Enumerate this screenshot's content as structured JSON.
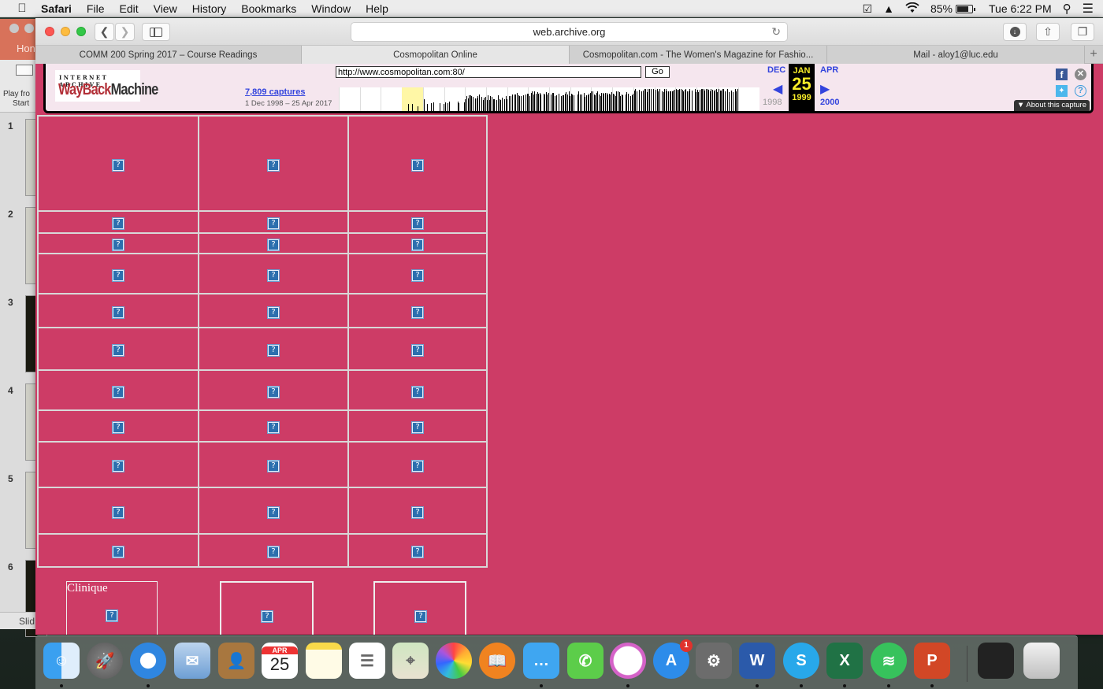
{
  "menubar": {
    "app": "Safari",
    "items": [
      "File",
      "Edit",
      "View",
      "History",
      "Bookmarks",
      "Window",
      "Help"
    ],
    "battery": "85%",
    "battery_level": 0.85,
    "clock": "Tue 6:22 PM"
  },
  "background_window": {
    "app": "PowerPoint",
    "ribbon_tab": "Hon",
    "play_label_1": "Play fro",
    "play_label_2": "Start",
    "slide_numbers": [
      "1",
      "2",
      "3",
      "4",
      "5",
      "6"
    ],
    "footer_label": "Slid"
  },
  "browser": {
    "address": "web.archive.org",
    "tabs": [
      {
        "label": "COMM 200 Spring 2017 – Course Readings",
        "active": false
      },
      {
        "label": "Cosmopolitan Online",
        "active": true
      },
      {
        "label": "Cosmopolitan.com - The Women's Magazine for Fashio...",
        "active": false
      },
      {
        "label": "Mail - aloy1@luc.edu",
        "active": false
      }
    ],
    "new_tab": "+"
  },
  "wayback": {
    "logo_top": "INTERNET ARCHIVE",
    "logo_way": "WayBack",
    "logo_machine": "Machine",
    "url_value": "http://www.cosmopolitan.com:80/",
    "go_label": "Go",
    "captures_link": "7,809 captures",
    "capture_range": "1 Dec 1998 – 25 Apr 2017",
    "prev_month": "DEC",
    "current_month": "JAN",
    "next_month": "APR",
    "current_day": "25",
    "prev_year": "1998",
    "current_year": "1999",
    "next_year": "2000",
    "about_label": "▼ About this capture",
    "facebook": "f",
    "twitter": "t",
    "close": "✕",
    "help": "?"
  },
  "page": {
    "background_color": "#cd3c66",
    "broken_image_glyph": "?",
    "grid_rows": 11,
    "grid_cols": 3,
    "bottom_boxes": [
      {
        "label": "Clinique"
      },
      {
        "label": ""
      },
      {
        "label": ""
      }
    ]
  },
  "dock": {
    "apps": [
      {
        "name": "Finder",
        "running": true
      },
      {
        "name": "Launchpad",
        "running": false
      },
      {
        "name": "Safari",
        "running": true
      },
      {
        "name": "Mail",
        "running": false
      },
      {
        "name": "Contacts",
        "running": false
      },
      {
        "name": "Calendar",
        "running": false,
        "month": "APR",
        "day": "25"
      },
      {
        "name": "Notes",
        "running": false
      },
      {
        "name": "Reminders",
        "running": false
      },
      {
        "name": "Maps",
        "running": false
      },
      {
        "name": "Photos",
        "running": false
      },
      {
        "name": "iBooks",
        "running": false
      },
      {
        "name": "Messages",
        "running": true
      },
      {
        "name": "FaceTime",
        "running": false
      },
      {
        "name": "iTunes",
        "running": true
      },
      {
        "name": "App Store",
        "running": false,
        "badge": "1"
      },
      {
        "name": "System Preferences",
        "running": false
      },
      {
        "name": "Microsoft Word",
        "running": true
      },
      {
        "name": "Skype",
        "running": true
      },
      {
        "name": "Microsoft Excel",
        "running": true
      },
      {
        "name": "Spotify",
        "running": true
      },
      {
        "name": "Microsoft PowerPoint",
        "running": true
      },
      {
        "name": "Spotify Window",
        "running": false
      },
      {
        "name": "Trash",
        "running": false
      }
    ]
  }
}
